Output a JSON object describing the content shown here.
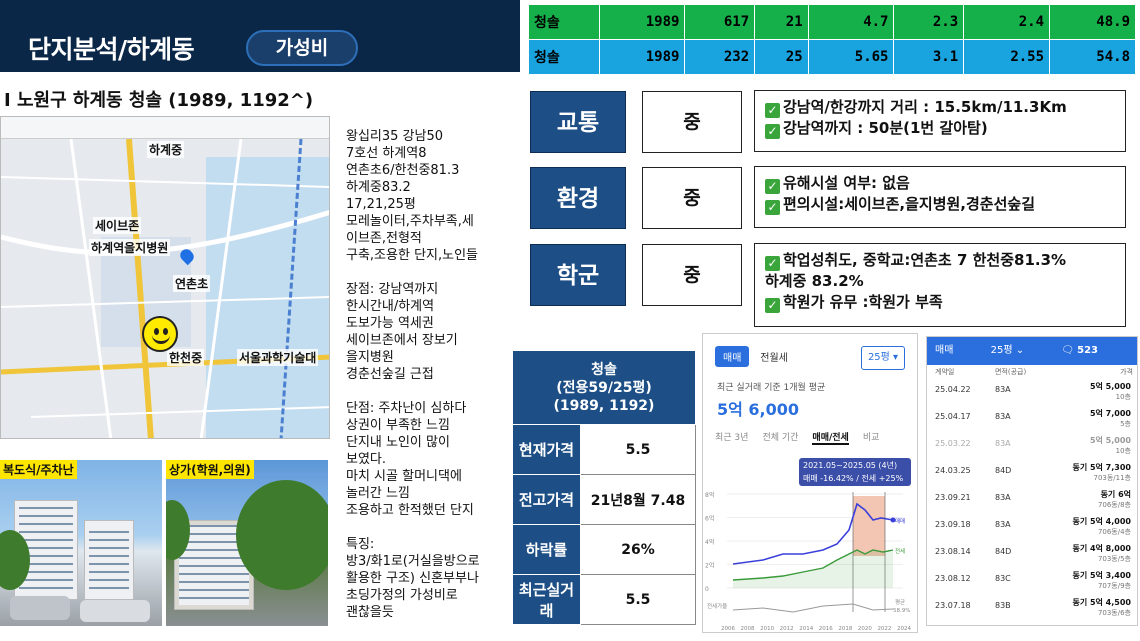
{
  "header": {
    "title": "단지분석/하계동",
    "badge": "가성비"
  },
  "subtitle": "I 노원구 하계동 청솔 (1989, 1192^)",
  "top_table": {
    "rows": [
      [
        "청솔",
        "1989",
        "617",
        "21",
        "4.7",
        "2.3",
        "2.4",
        "48.9"
      ],
      [
        "청솔",
        "1989",
        "232",
        "25",
        "5.65",
        "3.1",
        "2.55",
        "54.8"
      ]
    ],
    "row_colors": [
      "#15b04a",
      "#19a4df"
    ]
  },
  "map": {
    "labels": {
      "hagye_station": "하계중",
      "seven_bronze": "세이브존",
      "hagye_eulji": "하계역을지병원",
      "yeonchon": "연촌초",
      "hancheon": "한천중",
      "seoultech": "서울과학기술대"
    },
    "icons": [
      "smiley-face-icon",
      "location-pin-icon"
    ]
  },
  "notes": [
    "왕십리35 강남50",
    "7호선 하계역8",
    "연촌초6/한천중81.3",
    "하계중83.2",
    "17,21,25평",
    "모레놀이터,주차부족,세",
    "이브존,전형적",
    "구축,조용한 단지,노인들",
    "",
    "장점: 강남역까지",
    "한시간내/하계역",
    "도보가능 역세권",
    "세이브존에서 장보기",
    "을지병원",
    "경춘선숲길 근접",
    "",
    "단점: 주차난이 심하다",
    "상권이 부족한 느낌",
    "단지내 노인이 많이",
    "보였다.",
    "마치 시골 할머니댁에",
    "놀러간 느낌",
    "조용하고 한적했던 단지",
    "",
    "특징:",
    "방3/화1로(거실을방으로",
    "활용한 구조) 신혼부부나",
    "초딩가정의 가성비로",
    "괜찮을듯"
  ],
  "photos": {
    "left_caption": "복도식/주차난",
    "right_caption": "상가(학원,의원)"
  },
  "ratings": [
    {
      "label": "교통",
      "grade": "중",
      "lines": [
        "강남역/한강까지 거리 : 15.5km/11.3Km",
        "강남역까지 : 50분(1번 갈아탐)"
      ]
    },
    {
      "label": "환경",
      "grade": "중",
      "lines": [
        "유해시설 여부: 없음",
        "편의시설:세이브존,을지병원,경춘선숲길"
      ]
    },
    {
      "label": "학군",
      "grade": "중",
      "lines": [
        "학업성취도, 중학교:연촌초 7 한천중81.3%",
        "하계중 83.2%",
        "학원가 유무 :학원가 부족"
      ]
    }
  ],
  "ratings_check_flags": [
    [
      true,
      true
    ],
    [
      true,
      true
    ],
    [
      true,
      false,
      true
    ]
  ],
  "summary": {
    "header_lines": [
      "청솔",
      "(전용59/25평)",
      "(1989, 1192)"
    ],
    "rows": [
      {
        "key": "현재가격",
        "value": "5.5"
      },
      {
        "key": "전고가격",
        "value": "21년8월 7.48"
      },
      {
        "key": "하락률",
        "value": "26%"
      },
      {
        "key": "최근실거래",
        "value": "5.5"
      }
    ]
  },
  "price_card": {
    "tabs": [
      "매매",
      "전월세"
    ],
    "select": "25평 ▾",
    "caption": "최근 실거래 기준 1개월 평균",
    "price": "5억 6,000",
    "period_tabs": [
      "최근 3년",
      "전체 기간",
      "매매/전세",
      "비교"
    ],
    "tooltip": [
      "2021.05~2025.05 (4년)",
      "매매 -16.42% / 전세 +25%"
    ],
    "y_ticks": [
      "8억",
      "6억",
      "4억",
      "2억",
      "0"
    ],
    "x_ticks": [
      "2006",
      "2008",
      "2010",
      "2012",
      "2014",
      "2016",
      "2018",
      "2020",
      "2022",
      "2024"
    ],
    "series_labels": [
      "매매",
      "전세"
    ],
    "footer_left": "전세가율",
    "footer_right": [
      "평균",
      "58.9%"
    ],
    "colors": {
      "sale": "#3a3fd9",
      "jeonse": "#3a9b3a",
      "band": "#f0b7a0"
    }
  },
  "tx_card": {
    "bar": [
      "매매",
      "25평 ⌄",
      "523"
    ],
    "headers": [
      "계약일",
      "면적(공급)",
      "가격"
    ],
    "rows": [
      {
        "date": "25.04.22",
        "area": "83A",
        "price": "5억 5,000",
        "floor": "10층",
        "dim": false
      },
      {
        "date": "25.04.17",
        "area": "83A",
        "price": "5억 7,000",
        "floor": "5층",
        "dim": false
      },
      {
        "date": "25.03.22",
        "area": "83A",
        "price": "5억 5,000",
        "floor": "10층",
        "dim": true
      },
      {
        "date": "24.03.25",
        "area": "84D",
        "price": "동기 5억 7,300",
        "floor": "703동/11층",
        "dim": false
      },
      {
        "date": "23.09.21",
        "area": "83A",
        "price": "동기 6억",
        "floor": "706동/8층",
        "dim": false
      },
      {
        "date": "23.09.18",
        "area": "83A",
        "price": "동기 5억 4,000",
        "floor": "706동/4층",
        "dim": false
      },
      {
        "date": "23.08.14",
        "area": "84D",
        "price": "동기 4억 8,000",
        "floor": "703동/5층",
        "dim": false
      },
      {
        "date": "23.08.12",
        "area": "83C",
        "price": "동기 5억 3,400",
        "floor": "707동/9층",
        "dim": false
      },
      {
        "date": "23.07.18",
        "area": "83B",
        "price": "동기 5억 4,500",
        "floor": "703동/6층",
        "dim": false
      }
    ]
  }
}
